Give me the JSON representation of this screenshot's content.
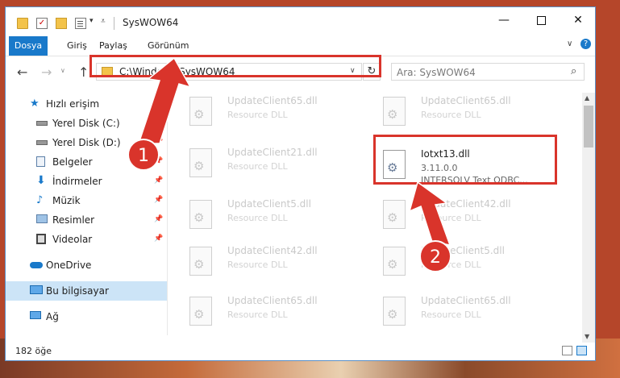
{
  "window": {
    "title": "SysWOW64",
    "min_glyph": "—",
    "close_glyph": "✕"
  },
  "ribbon": {
    "tabs": [
      "Dosya",
      "Giriş",
      "Paylaş",
      "Görünüm"
    ],
    "help_glyph": "?",
    "expand_glyph": "∨"
  },
  "navigation": {
    "address_path": "C:\\Windows\\SysWOW64",
    "search_placeholder": "Ara: SysWOW64",
    "back_glyph": "←",
    "forward_glyph": "→",
    "up_glyph": "↑",
    "refresh_glyph": "↻",
    "search_glyph": "⌕"
  },
  "sidebar": {
    "items": [
      {
        "label": "Hızlı erişim",
        "icon": "star-icon"
      },
      {
        "label": "Yerel Disk (C:)",
        "icon": "drive-icon",
        "pinned": true
      },
      {
        "label": "Yerel Disk (D:)",
        "icon": "drive-icon",
        "pinned": true
      },
      {
        "label": "Belgeler",
        "icon": "documents-icon",
        "pinned": true
      },
      {
        "label": "İndirmeler",
        "icon": "download-icon",
        "pinned": true
      },
      {
        "label": "Müzik",
        "icon": "music-icon",
        "pinned": true
      },
      {
        "label": "Resimler",
        "icon": "pictures-icon",
        "pinned": true
      },
      {
        "label": "Videolar",
        "icon": "videos-icon",
        "pinned": true
      },
      {
        "label": "OneDrive",
        "icon": "cloud-icon"
      },
      {
        "label": "Bu bilgisayar",
        "icon": "computer-icon",
        "selected": true
      },
      {
        "label": "Ağ",
        "icon": "network-icon"
      }
    ]
  },
  "files": {
    "left": [
      {
        "name": "UpdateClient65.dll",
        "type": "Resource DLL"
      },
      {
        "name": "UpdateClient21.dll",
        "type": "Resource DLL"
      },
      {
        "name": "UpdateClient5.dll",
        "type": "Resource DLL"
      },
      {
        "name": "UpdateClient42.dll",
        "type": "Resource DLL"
      },
      {
        "name": "UpdateClient65.dll",
        "type": "Resource DLL"
      }
    ],
    "right": [
      {
        "name": "UpdateClient65.dll",
        "type": "Resource DLL"
      },
      {
        "name": "UpdateClient42.dll",
        "type": "Resource DLL"
      },
      {
        "name": "UpdateClient5.dll",
        "type": "Resource DLL"
      },
      {
        "name": "UpdateClient65.dll",
        "type": "Resource DLL"
      }
    ],
    "highlighted": {
      "name": "Iotxt13.dll",
      "version": "3.11.0.0",
      "description": "INTERSOLV Text ODBC..."
    }
  },
  "status": {
    "item_count": "182 öğe"
  },
  "annotations": {
    "step1": "1",
    "step2": "2",
    "color": "#d9342b"
  }
}
